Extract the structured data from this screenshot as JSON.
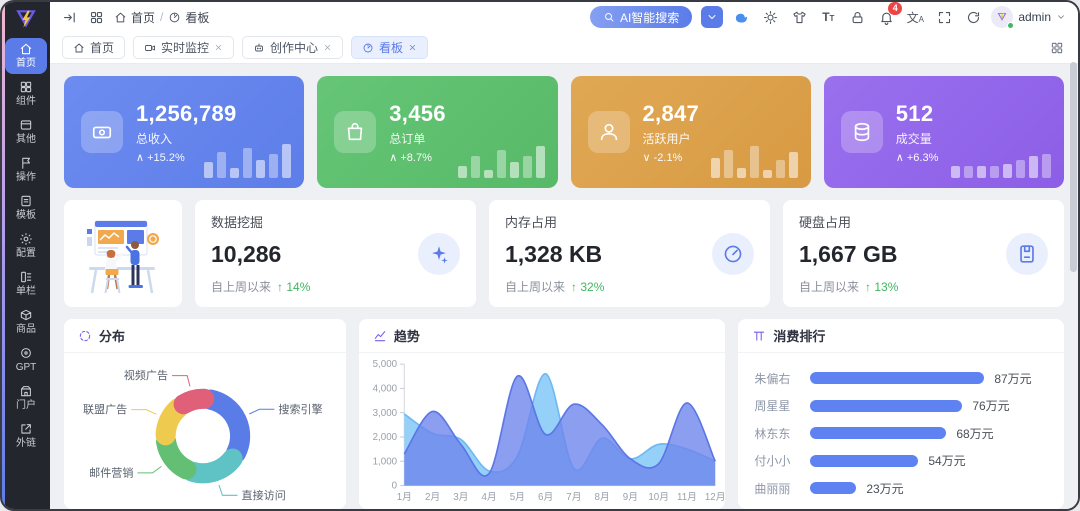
{
  "header": {
    "breadcrumb": {
      "separator": "/",
      "items": [
        {
          "icon": "home",
          "label": "首页"
        },
        {
          "icon": "dashboard",
          "label": "看板"
        }
      ]
    },
    "left_icons": [
      {
        "name": "collapse-sidebar-icon",
        "icon": "collapse"
      },
      {
        "name": "apps-menu-icon",
        "icon": "apps"
      }
    ],
    "search": {
      "label": "AI智能搜索",
      "icon": "search"
    },
    "quick_button": {
      "icon": "chevDown"
    },
    "icons": [
      {
        "name": "whale-assistant-icon",
        "icon": "whale"
      },
      {
        "name": "theme-brightness-icon",
        "icon": "sun"
      },
      {
        "name": "skin-theme-icon",
        "icon": "tshirt"
      },
      {
        "name": "font-size-icon",
        "icon": "textsize"
      },
      {
        "name": "lock-screen-icon",
        "icon": "lock"
      },
      {
        "name": "notifications-bell-icon",
        "icon": "bell",
        "badge": "4"
      },
      {
        "name": "language-translate-icon",
        "icon": "translate"
      },
      {
        "name": "fullscreen-icon",
        "icon": "full"
      },
      {
        "name": "refresh-icon",
        "icon": "refresh"
      }
    ],
    "user": {
      "name": "admin"
    }
  },
  "sidebar": {
    "items": [
      {
        "icon": "home",
        "label": "首页",
        "active": true
      },
      {
        "icon": "components",
        "label": "组件",
        "active": false
      },
      {
        "icon": "layers",
        "label": "其他",
        "active": false
      },
      {
        "icon": "flag",
        "label": "操作",
        "active": false
      },
      {
        "icon": "file",
        "label": "模板",
        "active": false
      },
      {
        "icon": "gear",
        "label": "配置",
        "active": false
      },
      {
        "icon": "column",
        "label": "单栏",
        "active": false
      },
      {
        "icon": "box",
        "label": "商品",
        "active": false
      },
      {
        "icon": "gpt",
        "label": "GPT",
        "active": false
      },
      {
        "icon": "portal",
        "label": "门户",
        "active": false
      },
      {
        "icon": "ext",
        "label": "外链",
        "active": false
      }
    ]
  },
  "tabs": {
    "items": [
      {
        "icon": "home",
        "label": "首页",
        "closable": false,
        "active": false
      },
      {
        "icon": "camera",
        "label": "实时监控",
        "closable": true,
        "active": false
      },
      {
        "icon": "robot",
        "label": "创作中心",
        "closable": true,
        "active": false
      },
      {
        "icon": "dashboard",
        "label": "看板",
        "closable": true,
        "active": true
      }
    ]
  },
  "stat_cards": [
    {
      "icon": "money",
      "value": "1,256,789",
      "label": "总收入",
      "dir": "up",
      "trend": "+15.2%",
      "color": "#5d7de9",
      "color2": "#6d8cf0",
      "bars": [
        16,
        26,
        10,
        30,
        18,
        24,
        34
      ]
    },
    {
      "icon": "bag",
      "value": "3,456",
      "label": "总订单",
      "dir": "up",
      "trend": "+8.7%",
      "color": "#57ba68",
      "color2": "#66c577",
      "bars": [
        12,
        22,
        8,
        28,
        16,
        22,
        32
      ]
    },
    {
      "icon": "user",
      "value": "2,847",
      "label": "活跃用户",
      "dir": "down",
      "trend": "-2.1%",
      "color": "#d89a43",
      "color2": "#e0a854",
      "bars": [
        20,
        28,
        10,
        32,
        8,
        18,
        26
      ]
    },
    {
      "icon": "db",
      "value": "512",
      "label": "成交量",
      "dir": "up",
      "trend": "+6.3%",
      "color": "#8c5ee6",
      "color2": "#9a70ee",
      "bars": [
        12,
        12,
        12,
        12,
        14,
        18,
        22,
        24
      ]
    }
  ],
  "metric_cards": [
    {
      "title": "数据挖掘",
      "value": "10,286",
      "footer": "自上周以来",
      "delta": "14%",
      "icon": "sparkles"
    },
    {
      "title": "内存占用",
      "value": "1,328 KB",
      "footer": "自上周以来",
      "delta": "32%",
      "icon": "gauge"
    },
    {
      "title": "硬盘占用",
      "value": "1,667 GB",
      "footer": "自上周以来",
      "delta": "13%",
      "icon": "drive"
    }
  ],
  "panels": [
    {
      "icon": "loader",
      "title": "分布"
    },
    {
      "icon": "trendicon",
      "title": "趋势"
    },
    {
      "icon": "ranking",
      "title": "消费排行"
    }
  ],
  "chart_data": [
    {
      "type": "pie",
      "donut": true,
      "title": "分布",
      "legend_position": "callout-labels",
      "labels": [
        "搜索引擎",
        "直接访问",
        "邮件营销",
        "联盟广告",
        "视频广告"
      ],
      "values": [
        32,
        22,
        18,
        16,
        12
      ],
      "colors": [
        "#5a7ce6",
        "#5fc2c5",
        "#62bf74",
        "#eecb4e",
        "#e0607a"
      ]
    },
    {
      "type": "area",
      "title": "趋势",
      "smooth": true,
      "grid": false,
      "x": [
        "1月",
        "2月",
        "3月",
        "4月",
        "5月",
        "6月",
        "7月",
        "8月",
        "9月",
        "10月",
        "11月",
        "12月"
      ],
      "ylim": [
        0,
        5000
      ],
      "yticks": [
        "0",
        "1,000",
        "2,000",
        "3,000",
        "4,000",
        "5,000"
      ],
      "series": [
        {
          "name": "light-blue-series",
          "color": "#8FCDF9",
          "stroke": "#6FB8F2",
          "opacity": 0.95,
          "values": [
            2950,
            2150,
            1900,
            600,
            1200,
            4600,
            700,
            1950,
            1100,
            1700,
            1500,
            1000
          ]
        },
        {
          "name": "indigo-series",
          "color": "#6E86EC",
          "stroke": "#5B76E6",
          "opacity": 0.8,
          "values": [
            1300,
            3050,
            1700,
            500,
            4500,
            2100,
            3350,
            2500,
            1100,
            900,
            3400,
            1000
          ]
        }
      ]
    },
    {
      "type": "bar-horizontal",
      "title": "消费排行",
      "unit": "万元",
      "xmax": 100,
      "color": "#5f82f2",
      "categories": [
        "朱偏右",
        "周星星",
        "林东东",
        "付小小",
        "曲丽丽"
      ],
      "values": [
        87,
        76,
        68,
        54,
        23
      ],
      "value_labels": [
        "87万元",
        "76万元",
        "68万元",
        "54万元",
        "23万元"
      ]
    }
  ]
}
